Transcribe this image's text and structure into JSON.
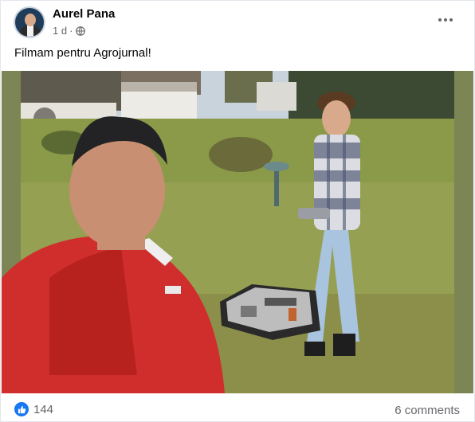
{
  "post": {
    "author": "Aurel Pana",
    "time": "1 d",
    "separator": "·",
    "privacy_icon": "globe-icon",
    "text": "Filmam pentru Agrojurnal!"
  },
  "engagement": {
    "reaction_icon": "like-icon",
    "reaction_count": "144",
    "comments": "6 comments"
  },
  "colors": {
    "like_blue": "#1877f2",
    "secondary_text": "#65676b",
    "photo_border": "#7b8654"
  }
}
